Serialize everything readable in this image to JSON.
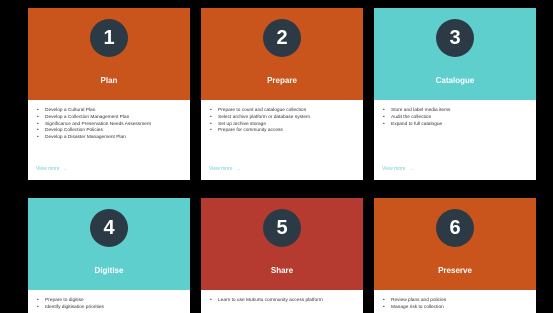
{
  "colors": {
    "orange": "#c9541c",
    "teal": "#5fcfce",
    "red": "#b53a30",
    "badge": "#2b3a44",
    "link": "#6fd0d0"
  },
  "cards": [
    {
      "number": "1",
      "title": "Plan",
      "color": "#c9541c",
      "items": [
        "Develop a Cultural Plan",
        "Develop a Collection Management Plan",
        "Significance and Preservation Needs Assessment",
        "Develop Collection Policies",
        "Develop a Disaster Management Plan"
      ],
      "more": "View more"
    },
    {
      "number": "2",
      "title": "Prepare",
      "color": "#c9541c",
      "items": [
        "Prepare to count and catalogue collection",
        "Select archive platform or database system",
        "Set up archive storage",
        "Prepare for community access"
      ],
      "more": "View more"
    },
    {
      "number": "3",
      "title": "Catalogue",
      "color": "#5fcfce",
      "items": [
        "Store and label media items",
        "Audit the collection",
        "Expand to full catalogue"
      ],
      "more": "View more"
    },
    {
      "number": "4",
      "title": "Digitise",
      "color": "#5fcfce",
      "items": [
        "Prepare to digitise",
        "Identify digitisation priorities"
      ],
      "more": ""
    },
    {
      "number": "5",
      "title": "Share",
      "color": "#b53a30",
      "items": [
        "Learn to use Mukurtu community access platform"
      ],
      "more": ""
    },
    {
      "number": "6",
      "title": "Preserve",
      "color": "#c9541c",
      "items": [
        "Review plans and policies",
        "Manage risk to collection"
      ],
      "more": ""
    }
  ]
}
